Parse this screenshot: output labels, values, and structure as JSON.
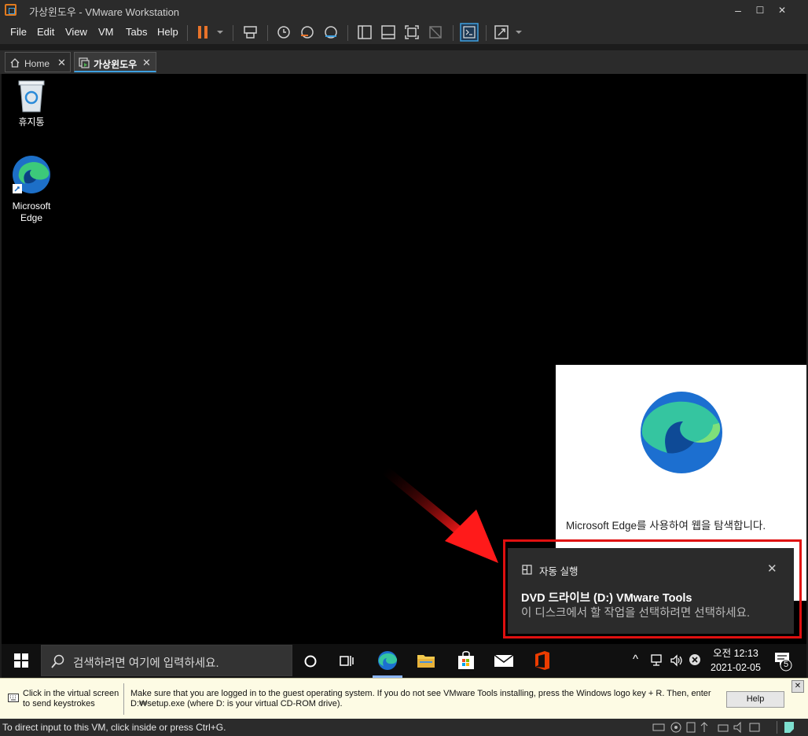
{
  "window": {
    "title": "가상윈도우 - VMware Workstation",
    "min": "–",
    "max": "☐",
    "close": "✕"
  },
  "menu": [
    "File",
    "Edit",
    "View",
    "VM",
    "Tabs",
    "Help"
  ],
  "tabs": [
    {
      "label": "Home",
      "close": "✕"
    },
    {
      "label": "가상윈도우",
      "close": "✕"
    }
  ],
  "desktop": {
    "recycle_bin": "휴지통",
    "edge": {
      "line1": "Microsoft",
      "line2": "Edge"
    }
  },
  "edge_card": {
    "message": "Microsoft Edge를 사용하여 웹을 탐색합니다."
  },
  "toast": {
    "header": "자동 실행",
    "title": "DVD 드라이브 (D:) VMware Tools",
    "body": "이 디스크에서 할 작업을 선택하려면 선택하세요.",
    "close": "✕"
  },
  "taskbar": {
    "search_placeholder": "검색하려면 여기에 입력하세요.",
    "clock_time": "오전 12:13",
    "clock_date": "2021-02-05",
    "notification_count": "5",
    "tray_chevron": "^"
  },
  "hint": {
    "left_line1": "Click in the virtual screen",
    "left_line2": "to send keystrokes",
    "main_line1": "Make sure that you are logged in to the guest operating system. If you do not see VMware Tools installing, press the Windows logo key + R. Then, enter",
    "main_line2": "D:₩setup.exe (where D: is your virtual CD-ROM drive).",
    "help": "Help",
    "close": "✕"
  },
  "status": {
    "text": "To direct input to this VM, click inside or press Ctrl+G."
  }
}
